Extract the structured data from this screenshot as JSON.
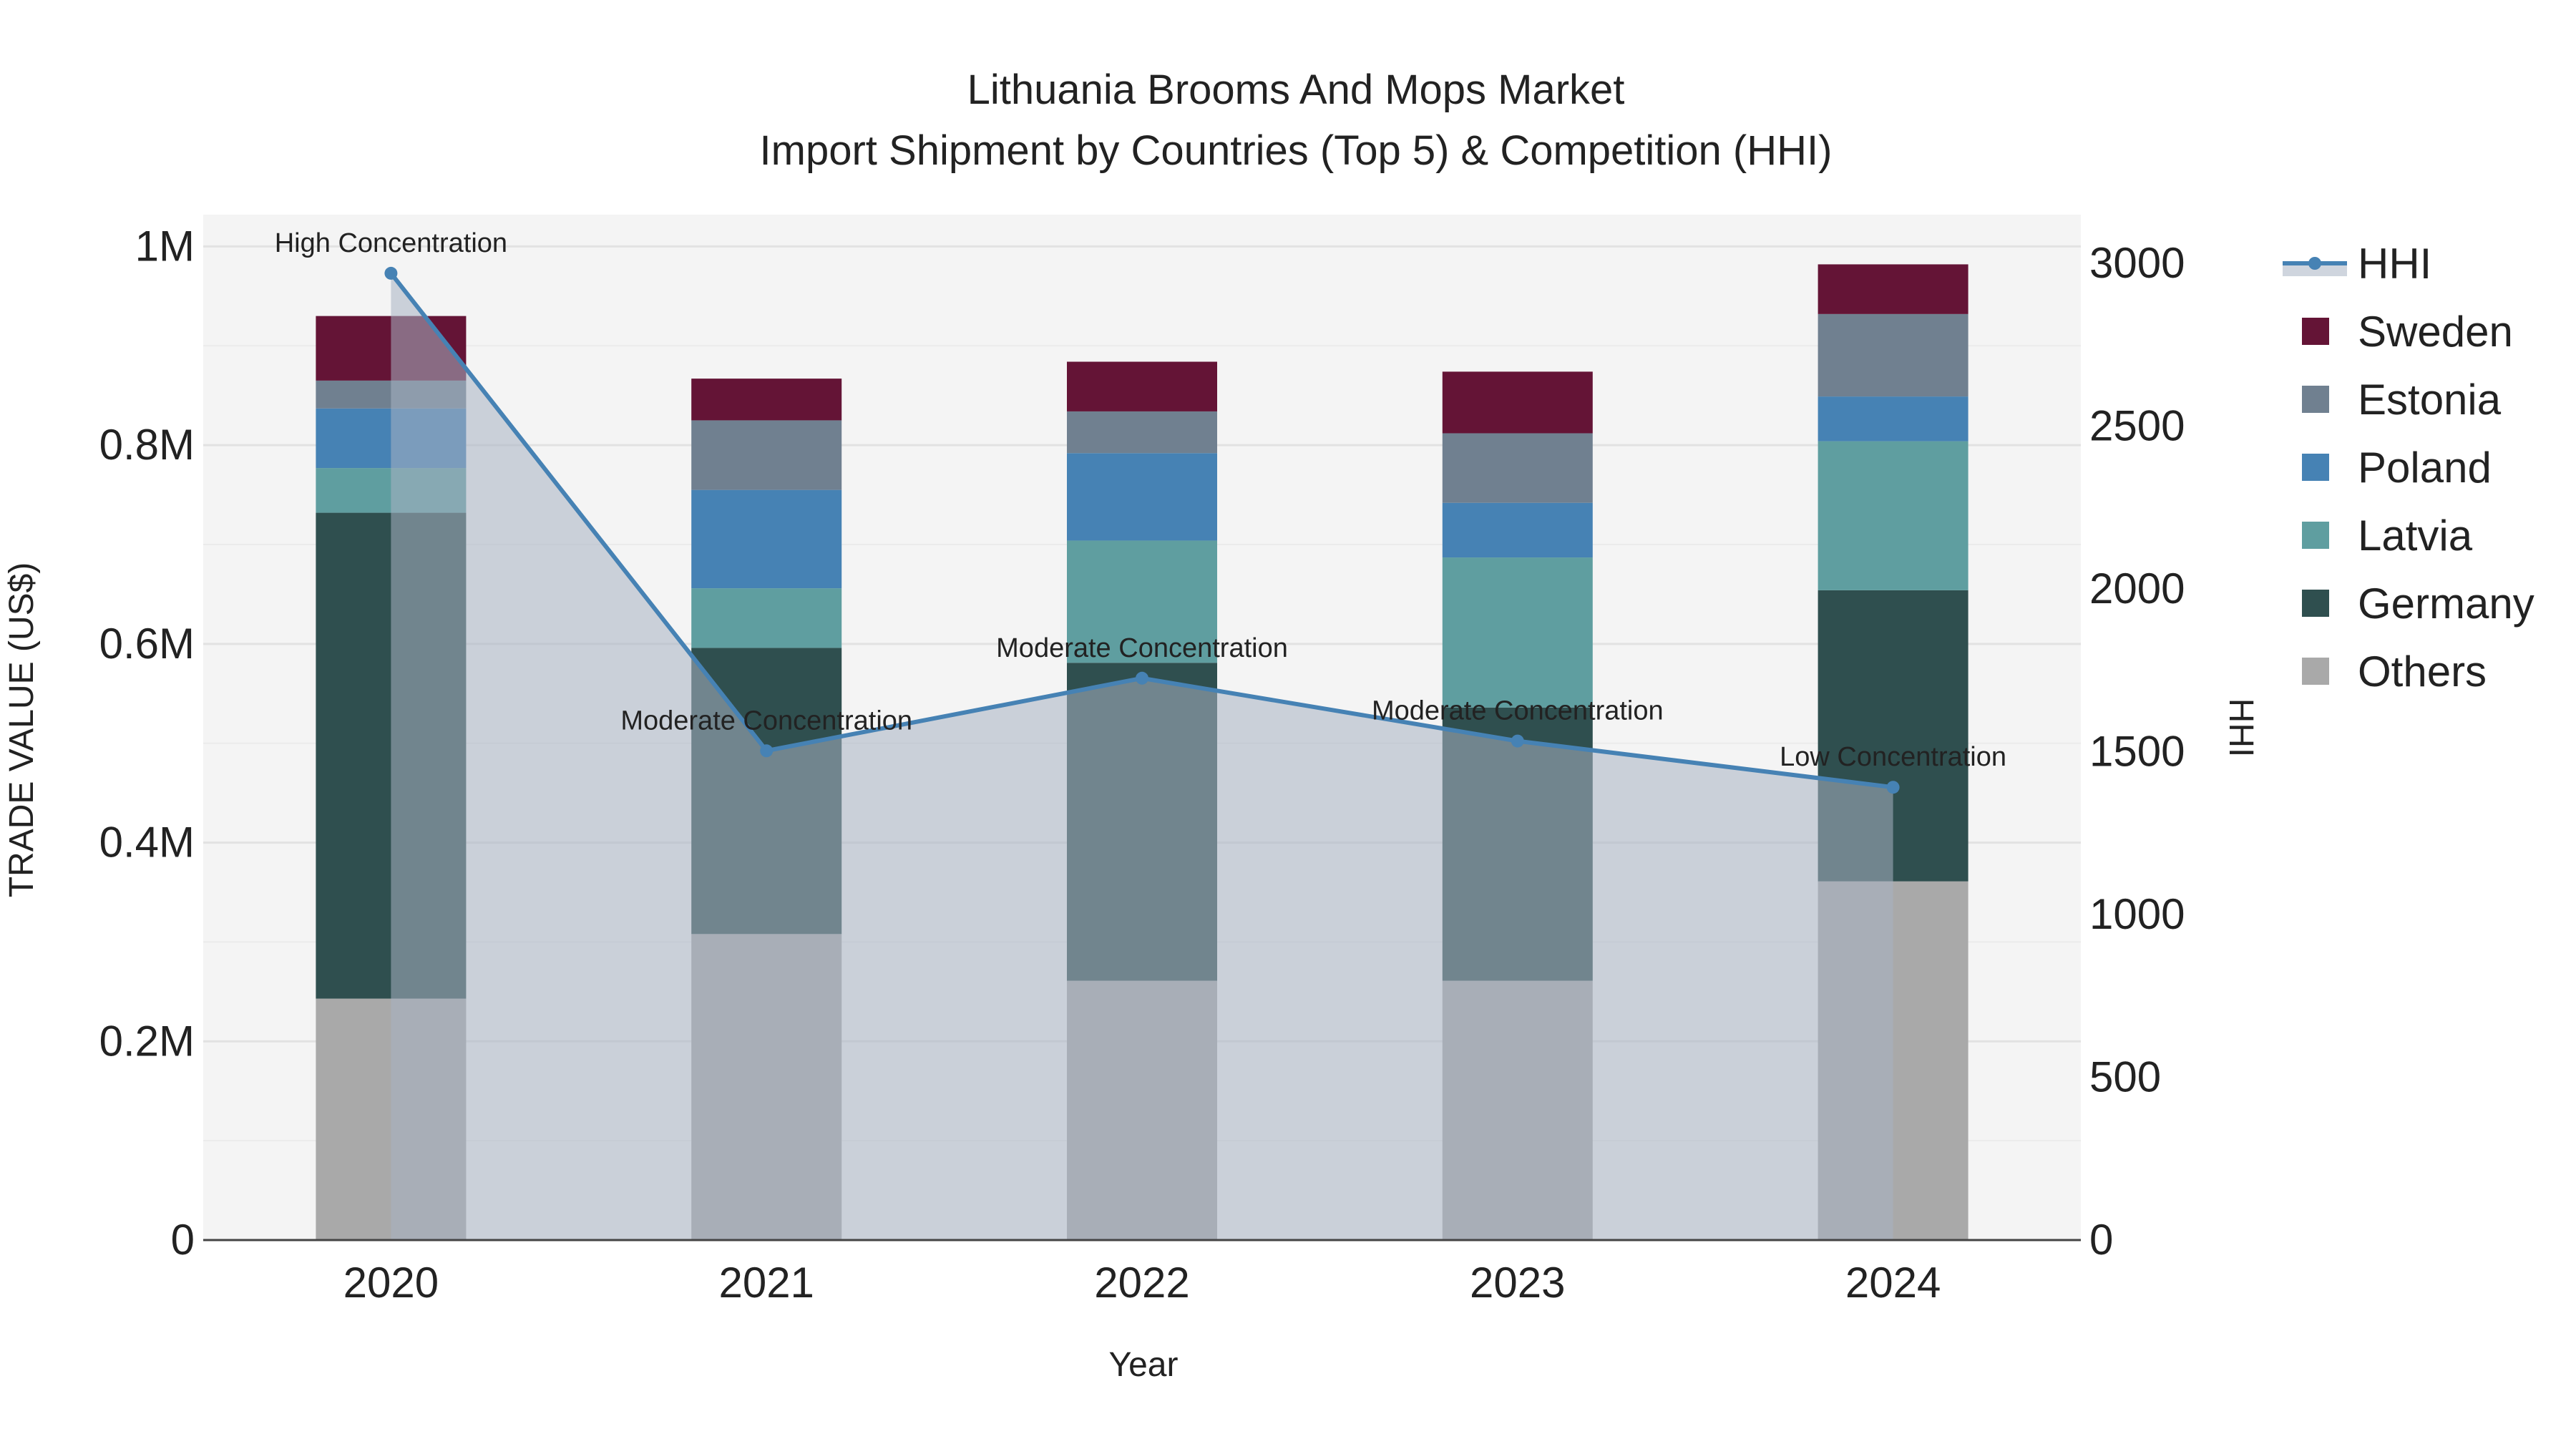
{
  "chart_data": {
    "type": "bar",
    "title": "Lithuania Brooms And Mops Market",
    "subtitle": "Import Shipment by Countries (Top 5) & Competition (HHI)",
    "xlabel": "Year",
    "ylabel": "TRADE VALUE (US$)",
    "y2label": "HHI",
    "categories": [
      "2020",
      "2021",
      "2022",
      "2023",
      "2024"
    ],
    "ylim": [
      0,
      1032000
    ],
    "y2lim": [
      0,
      3150
    ],
    "yticks": [
      {
        "v": 0,
        "label": "0"
      },
      {
        "v": 200000,
        "label": "0.2M"
      },
      {
        "v": 400000,
        "label": "0.4M"
      },
      {
        "v": 600000,
        "label": "0.6M"
      },
      {
        "v": 800000,
        "label": "0.8M"
      },
      {
        "v": 1000000,
        "label": "1M"
      }
    ],
    "y2ticks": [
      {
        "v": 0,
        "label": "0"
      },
      {
        "v": 500,
        "label": "500"
      },
      {
        "v": 1000,
        "label": "1000"
      },
      {
        "v": 1500,
        "label": "1500"
      },
      {
        "v": 2000,
        "label": "2000"
      },
      {
        "v": 2500,
        "label": "2500"
      },
      {
        "v": 3000,
        "label": "3000"
      }
    ],
    "grid": true,
    "stacked": true,
    "legend_position": "right",
    "series": [
      {
        "name": "Others",
        "color": "#a9a9a9",
        "values": [
          243000,
          308000,
          261000,
          261000,
          361000
        ]
      },
      {
        "name": "Germany",
        "color": "#2f4f4f",
        "values": [
          489000,
          288000,
          320000,
          275000,
          293000
        ]
      },
      {
        "name": "Latvia",
        "color": "#5f9ea0",
        "values": [
          45000,
          60000,
          123000,
          151000,
          150000
        ]
      },
      {
        "name": "Poland",
        "color": "#4682b4",
        "values": [
          60000,
          99000,
          88000,
          55000,
          45000
        ]
      },
      {
        "name": "Estonia",
        "color": "#708090",
        "values": [
          28000,
          70000,
          42000,
          70000,
          83000
        ]
      },
      {
        "name": "Sweden",
        "color": "#641436",
        "values": [
          65000,
          42000,
          50000,
          62000,
          50000
        ]
      }
    ],
    "line": {
      "name": "HHI",
      "color": "#4682b4",
      "values": [
        2970,
        1503,
        1726,
        1533,
        1391
      ],
      "annotations": [
        "High Concentration",
        "Moderate Concentration",
        "Moderate Concentration",
        "Moderate Concentration",
        "Low Concentration"
      ]
    },
    "legend_order": [
      "HHI",
      "Sweden",
      "Estonia",
      "Poland",
      "Latvia",
      "Germany",
      "Others"
    ]
  }
}
